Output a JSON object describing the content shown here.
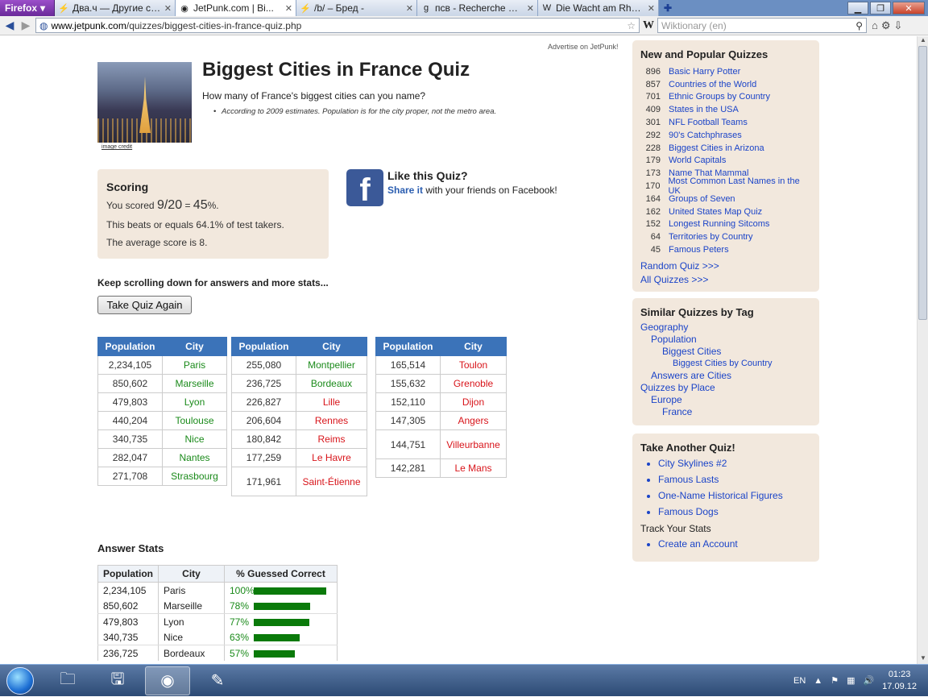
{
  "browser": {
    "firefox_label": "Firefox",
    "tabs": [
      {
        "icon": "⚡",
        "title": "Два.ч — Другие ст...",
        "active": false
      },
      {
        "icon": "◉",
        "title": "JetPunk.com | Bi...",
        "active": true
      },
      {
        "icon": "⚡",
        "title": "/b/ – Бред -",
        "active": false
      },
      {
        "icon": "g",
        "title": "псв - Recherche G...",
        "active": false
      },
      {
        "icon": "W",
        "title": "Die Wacht am Rhei...",
        "active": false
      }
    ],
    "url_domain": "www.jetpunk.com",
    "url_path": "/quizzes/biggest-cities-in-france-quiz.php",
    "search_placeholder": "Wiktionary (en)"
  },
  "page": {
    "advertise": "Advertise on JetPunk!",
    "image_credit": "image credit",
    "title": "Biggest Cities in France Quiz",
    "subtitle": "How many of France's biggest cities can you name?",
    "note": "According to 2009 estimates. Population is for the city proper, not the metro area.",
    "scoring": {
      "heading": "Scoring",
      "score_prefix": "You scored",
      "score_value": "9/20",
      "score_eq": "=",
      "score_pct": "45",
      "score_suffix": "%.",
      "beats": "This beats or equals 64.1% of test takers.",
      "average": "The average score is 8."
    },
    "fb": {
      "letter": "f",
      "title": "Like this Quiz?",
      "share_link": "Share it",
      "share_rest": " with your friends on Facebook!"
    },
    "keep_scrolling": "Keep scrolling down for answers and more stats...",
    "take_again": "Take Quiz Again",
    "results_headers": {
      "pop": "Population",
      "city": "City"
    },
    "results": [
      [
        {
          "pop": "2,234,105",
          "city": "Paris",
          "ok": true
        },
        {
          "pop": "850,602",
          "city": "Marseille",
          "ok": true
        },
        {
          "pop": "479,803",
          "city": "Lyon",
          "ok": true
        },
        {
          "pop": "440,204",
          "city": "Toulouse",
          "ok": true
        },
        {
          "pop": "340,735",
          "city": "Nice",
          "ok": true
        },
        {
          "pop": "282,047",
          "city": "Nantes",
          "ok": true
        },
        {
          "pop": "271,708",
          "city": "Strasbourg",
          "ok": true
        }
      ],
      [
        {
          "pop": "255,080",
          "city": "Montpellier",
          "ok": true
        },
        {
          "pop": "236,725",
          "city": "Bordeaux",
          "ok": true
        },
        {
          "pop": "226,827",
          "city": "Lille",
          "ok": false
        },
        {
          "pop": "206,604",
          "city": "Rennes",
          "ok": false
        },
        {
          "pop": "180,842",
          "city": "Reims",
          "ok": false
        },
        {
          "pop": "177,259",
          "city": "Le Havre",
          "ok": false
        },
        {
          "pop": "171,961",
          "city": "Saint-Étienne",
          "ok": false
        }
      ],
      [
        {
          "pop": "165,514",
          "city": "Toulon",
          "ok": false
        },
        {
          "pop": "155,632",
          "city": "Grenoble",
          "ok": false
        },
        {
          "pop": "152,110",
          "city": "Dijon",
          "ok": false
        },
        {
          "pop": "147,305",
          "city": "Angers",
          "ok": false
        },
        {
          "pop": "144,751",
          "city": "Villeurbanne",
          "ok": false
        },
        {
          "pop": "142,281",
          "city": "Le Mans",
          "ok": false
        }
      ]
    ],
    "answer_stats": {
      "heading": "Answer Stats",
      "headers": [
        "Population",
        "City",
        "% Guessed Correct"
      ],
      "rows": [
        {
          "pop": "2,234,105",
          "city": "Paris",
          "pct": 100
        },
        {
          "pop": "850,602",
          "city": "Marseille",
          "pct": 78
        },
        {
          "pop": "479,803",
          "city": "Lyon",
          "pct": 77
        },
        {
          "pop": "340,735",
          "city": "Nice",
          "pct": 63
        },
        {
          "pop": "236,725",
          "city": "Bordeaux",
          "pct": 57
        }
      ]
    }
  },
  "sidebar": {
    "popular": {
      "heading": "New and Popular Quizzes",
      "items": [
        {
          "n": "896",
          "t": "Basic Harry Potter"
        },
        {
          "n": "857",
          "t": "Countries of the World"
        },
        {
          "n": "701",
          "t": "Ethnic Groups by Country"
        },
        {
          "n": "409",
          "t": "States in the USA"
        },
        {
          "n": "301",
          "t": "NFL Football Teams"
        },
        {
          "n": "292",
          "t": "90's Catchphrases"
        },
        {
          "n": "228",
          "t": "Biggest Cities in Arizona"
        },
        {
          "n": "179",
          "t": "World Capitals"
        },
        {
          "n": "173",
          "t": "Name That Mammal"
        },
        {
          "n": "170",
          "t": "Most Common Last Names in the UK"
        },
        {
          "n": "164",
          "t": "Groups of Seven"
        },
        {
          "n": "162",
          "t": "United States Map Quiz"
        },
        {
          "n": "152",
          "t": "Longest Running Sitcoms"
        },
        {
          "n": "64",
          "t": "Territories by Country"
        },
        {
          "n": "45",
          "t": "Famous Peters"
        }
      ],
      "random": "Random Quiz >>>",
      "all": "All Quizzes >>>"
    },
    "similar": {
      "heading": "Similar Quizzes by Tag",
      "tags": [
        {
          "t": "Geography",
          "lvl": 1
        },
        {
          "t": "Population",
          "lvl": 2
        },
        {
          "t": "Biggest Cities",
          "lvl": 3
        },
        {
          "t": "Biggest Cities by Country",
          "lvl": 4
        },
        {
          "t": "Answers are Cities",
          "lvl": 2
        },
        {
          "t": "Quizzes by Place",
          "lvl": 1
        },
        {
          "t": "Europe",
          "lvl": 2
        },
        {
          "t": "France",
          "lvl": 3
        }
      ]
    },
    "another": {
      "heading": "Take Another Quiz!",
      "items": [
        "City Skylines #2",
        "Famous Lasts",
        "One-Name Historical Figures",
        "Famous Dogs"
      ],
      "track": "Track Your Stats",
      "create": "Create an Account"
    }
  },
  "taskbar": {
    "lang": "EN",
    "time": "01:23",
    "date": "17.09.12"
  },
  "colors": {
    "header_blue": "#3b73b9",
    "correct_green": "#1a8a1a",
    "missed_red": "#d8141a",
    "box_beige": "#f2e8dd",
    "link_blue": "#1b44c8"
  }
}
